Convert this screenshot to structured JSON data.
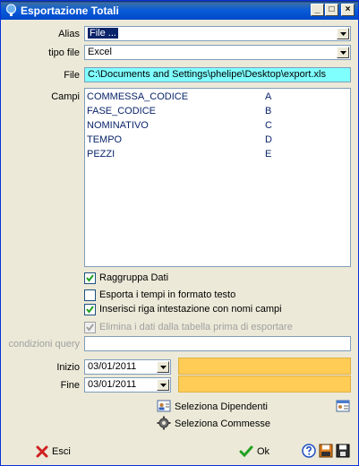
{
  "window": {
    "title": "Esportazione Totali"
  },
  "titlebar": {
    "minimize": "_",
    "maximize": "□",
    "close": "×"
  },
  "form": {
    "alias_label": "Alias",
    "alias_value": "File ...",
    "tipo_file_label": "tipo file",
    "tipo_file_value": "Excel",
    "file_label": "File",
    "file_value": "C:\\Documents and Settings\\phelipe\\Desktop\\export.xls",
    "campi_label": "Campi",
    "campi": [
      {
        "name": "COMMESSA_CODICE",
        "col": "A"
      },
      {
        "name": "FASE_CODICE",
        "col": "B"
      },
      {
        "name": "NOMINATIVO",
        "col": "C"
      },
      {
        "name": "TEMPO",
        "col": "D"
      },
      {
        "name": "PEZZI",
        "col": "E"
      }
    ],
    "raggruppa_label": "Raggruppa Dati",
    "raggruppa_checked": true,
    "esporta_tempi_label": "Esporta i tempi in formato testo",
    "esporta_tempi_checked": false,
    "inserisci_riga_label": "Inserisci riga intestazione con nomi campi",
    "inserisci_riga_checked": true,
    "elimina_label": "Elimina i dati dalla tabella prima di esportare",
    "elimina_checked": true,
    "condizioni_label": "condizioni query",
    "condizioni_value": "",
    "inizio_label": "Inizio",
    "inizio_value": "03/01/2011",
    "fine_label": "Fine",
    "fine_value": "03/01/2011"
  },
  "actions": {
    "seleziona_dipendenti": "Seleziona Dipendenti",
    "seleziona_commesse": "Seleziona Commesse",
    "esci": "Esci",
    "ok": "Ok"
  },
  "colors": {
    "accent_yellow": "#ffcc55",
    "file_field": "#80ffff",
    "list_text": "#0a246a"
  }
}
